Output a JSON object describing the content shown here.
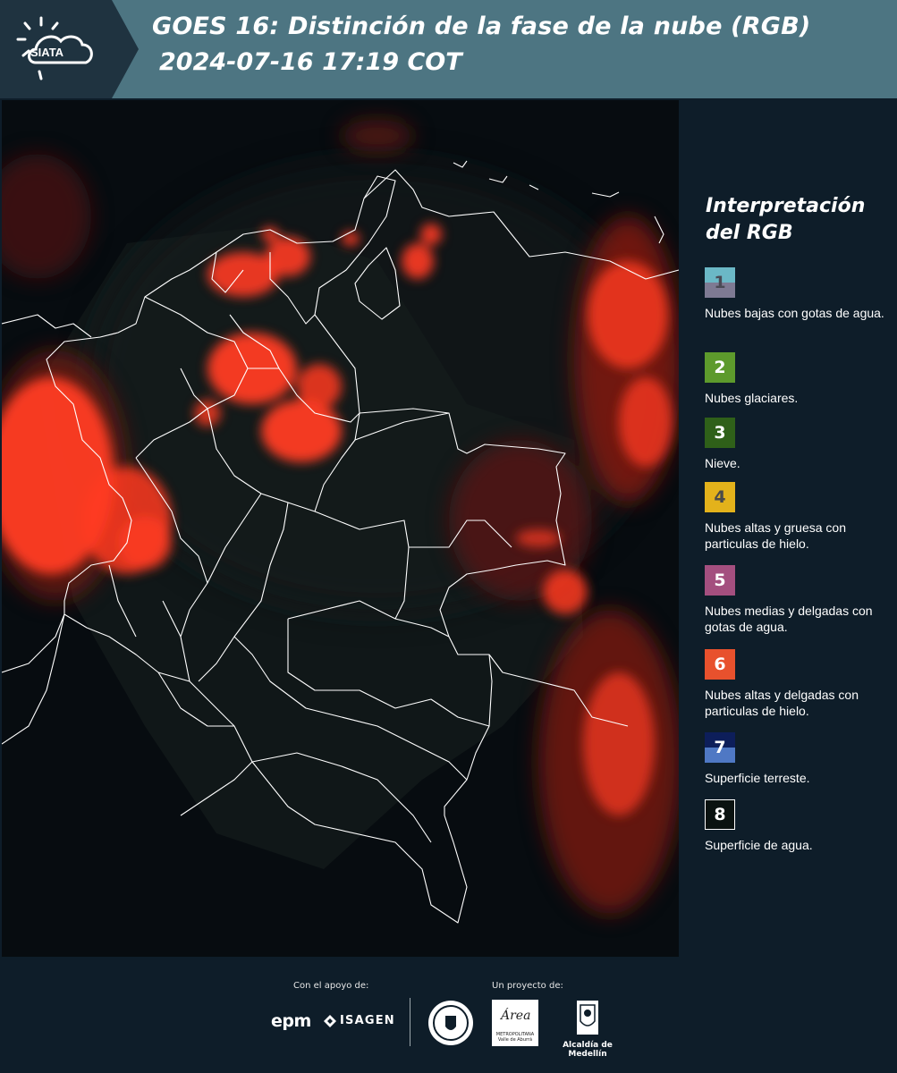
{
  "header": {
    "logo_text": "SIATA",
    "title": "GOES 16: Distinción de la fase de la nube (RGB)",
    "subtitle": "2024-07-16 17:19 COT"
  },
  "legend": {
    "title": "Interpretación del RGB",
    "items": [
      {
        "num": "1",
        "label": "Nubes bajas con gotas de agua.",
        "color_top": "#6bb8c6",
        "color_bottom": "#7e7a93",
        "num_color": "#4a4a55"
      },
      {
        "num": "2",
        "label": "Nubes glaciares.",
        "color_top": "#5d9a2c",
        "color_bottom": "#5d9a2c",
        "num_color": "#ffffff"
      },
      {
        "num": "3",
        "label": "Nieve.",
        "color_top": "#2f6019",
        "color_bottom": "#2f6019",
        "num_color": "#ffffff"
      },
      {
        "num": "4",
        "label": "Nubes altas y gruesa con particulas de hielo.",
        "color_top": "#e3b21b",
        "color_bottom": "#e3b21b",
        "num_color": "#4a4a4a"
      },
      {
        "num": "5",
        "label": "Nubes medias y delgadas con gotas de agua.",
        "color_top": "#a44f7f",
        "color_bottom": "#a44f7f",
        "num_color": "#ffffff"
      },
      {
        "num": "6",
        "label": "Nubes altas y delgadas con particulas de hielo.",
        "color_top": "#e8512d",
        "color_bottom": "#e8512d",
        "num_color": "#ffffff"
      },
      {
        "num": "7",
        "label": "Superficie terreste.",
        "color_top": "#0d1e5a",
        "color_bottom": "#4f78c4",
        "num_color": "#ffffff"
      },
      {
        "num": "8",
        "label": "Superficie de agua.",
        "color_top": "#0a1210",
        "color_bottom": "#0a1210",
        "num_color": "#ffffff"
      }
    ]
  },
  "footer": {
    "support_label": "Con el apoyo de:",
    "project_label": "Un proyecto de:",
    "epm": "epm",
    "isagen": "ISAGEN",
    "area_name": "Área",
    "area_sub": "METROPOLITANA Valle de Aburrá",
    "alcaldia": "Alcaldía de Medellín"
  },
  "colors": {
    "header_bg": "#4d7582",
    "page_bg": "#0e1d29",
    "cloud_red": "#ff3b22",
    "border_white": "#ffffff"
  }
}
